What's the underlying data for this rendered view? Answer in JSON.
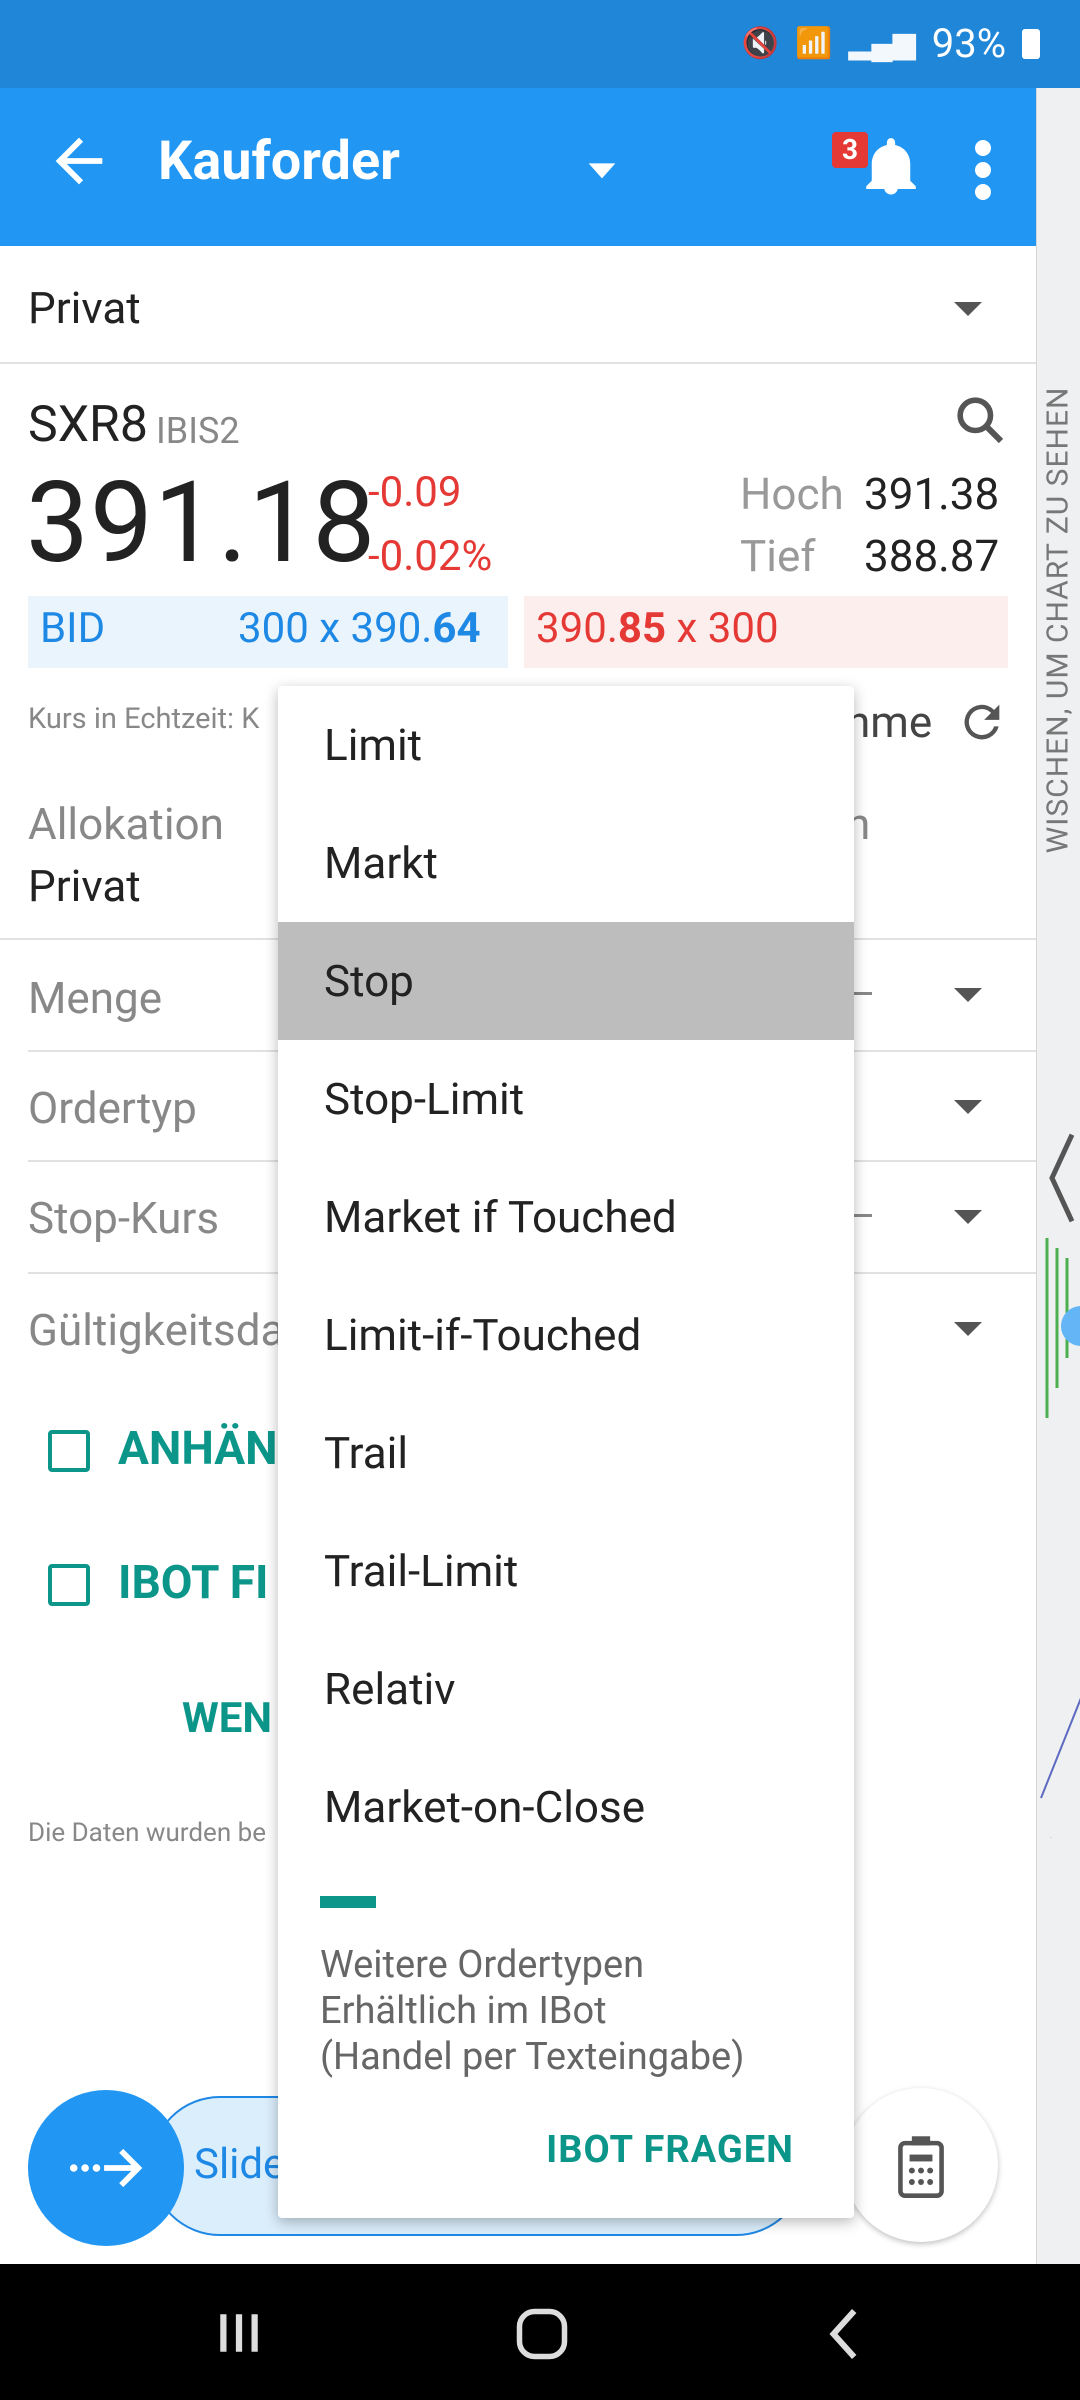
{
  "status_bar": {
    "battery_text": "93%"
  },
  "app_bar": {
    "title": "Kauforder",
    "notification_count": "3"
  },
  "side_hint": "WISCHEN, UM CHART ZU SEHEN",
  "account": {
    "value": "Privat"
  },
  "quote": {
    "symbol": "SXR8",
    "exchange": "IBIS2",
    "last": "391.18",
    "change": "-0.09",
    "change_pct": "-0.02%",
    "high_label": "Hoch",
    "high_value": "391.38",
    "low_label": "Tief",
    "low_value": "388.87",
    "bid_label": "BID",
    "bid_size": "300 x 390.",
    "bid_frac": "64",
    "ask_int": "390.",
    "ask_frac": "85",
    "ask_size": " x 300",
    "realtime_text": "Kurs in Echtzeit: K",
    "refresh_text": "hme"
  },
  "form": {
    "allocation_label": "Allokation",
    "allocation_value": "Privat",
    "allocation_right": "n",
    "quantity_label": "Menge",
    "ordertype_label": "Ordertyp",
    "stop_label": "Stop-Kurs",
    "validity_label": "Gültigkeitsda",
    "attach_label": "ANHÄN",
    "ibot_label": "IBOT FI",
    "wen_label": "WEN",
    "data_note": "Die Daten wurden be"
  },
  "slider": {
    "text": "Slide"
  },
  "menu": {
    "items": [
      "Limit",
      "Markt",
      "Stop",
      "Stop-Limit",
      "Market if Touched",
      "Limit-if-Touched",
      "Trail",
      "Trail-Limit",
      "Relativ",
      "Market-on-Close"
    ],
    "selected": "Stop",
    "note_line1": "Weitere Ordertypen",
    "note_line2": "Erhältlich im IBot",
    "note_line3": "(Handel per Texteingabe)",
    "ibot_button": "IBOT FRAGEN"
  },
  "colors": {
    "primary": "#2196f3",
    "accent": "#0c968a",
    "negative": "#e53935"
  }
}
